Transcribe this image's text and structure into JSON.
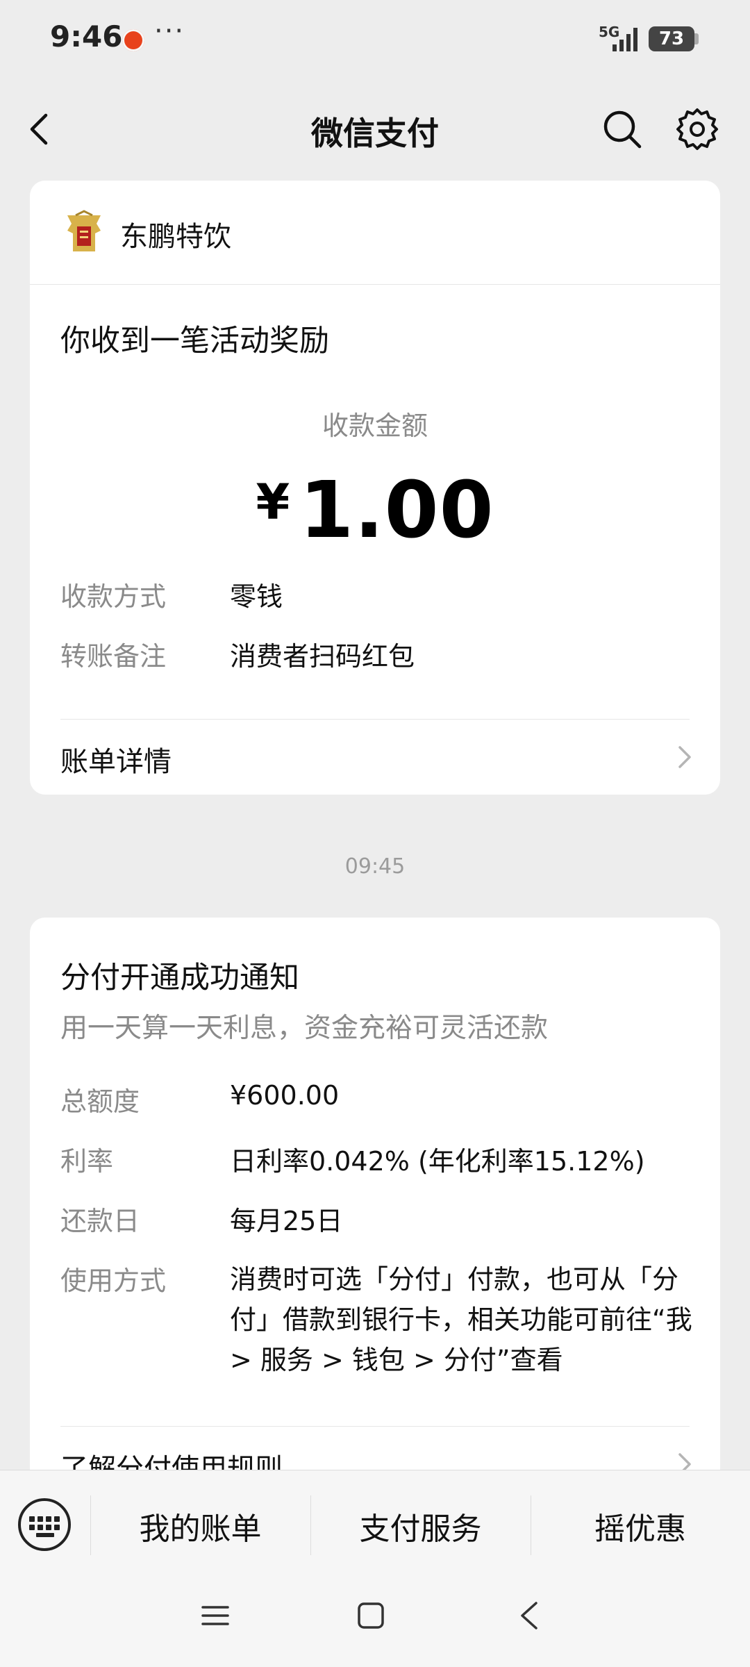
{
  "status_bar": {
    "time": "9:46",
    "more": "···",
    "network": "5G",
    "battery": "73"
  },
  "title_bar": {
    "title": "微信支付"
  },
  "payment_card": {
    "merchant_name": "东鹏特饮",
    "heading": "你收到一笔活动奖励",
    "amount_label": "收款金额",
    "currency": "¥",
    "amount": "1.00",
    "rows": [
      {
        "label": "收款方式",
        "value": "零钱"
      },
      {
        "label": "转账备注",
        "value": "消费者扫码红包"
      }
    ],
    "detail_link": "账单详情"
  },
  "timestamp": "09:45",
  "notice_card": {
    "heading": "分付开通成功通知",
    "subtitle": "用一天算一天利息，资金充裕可灵活还款",
    "rows": [
      {
        "label": "总额度",
        "value": "¥600.00"
      },
      {
        "label": "利率",
        "value": "日利率0.042% (年化利率15.12%)"
      },
      {
        "label": "还款日",
        "value": "每月25日"
      },
      {
        "label": "使用方式",
        "value": "消费时可选「分付」付款，也可从「分付」借款到银行卡，相关功能可前往“我 > 服务 > 钱包 > 分付”查看"
      }
    ],
    "rules_link": "了解分付使用规则"
  },
  "bottom_menu": {
    "items": [
      "我的账单",
      "支付服务",
      "摇优惠"
    ]
  },
  "colors": {
    "background": "#ededed",
    "card": "#ffffff",
    "notification_dot": "#e8421c"
  }
}
